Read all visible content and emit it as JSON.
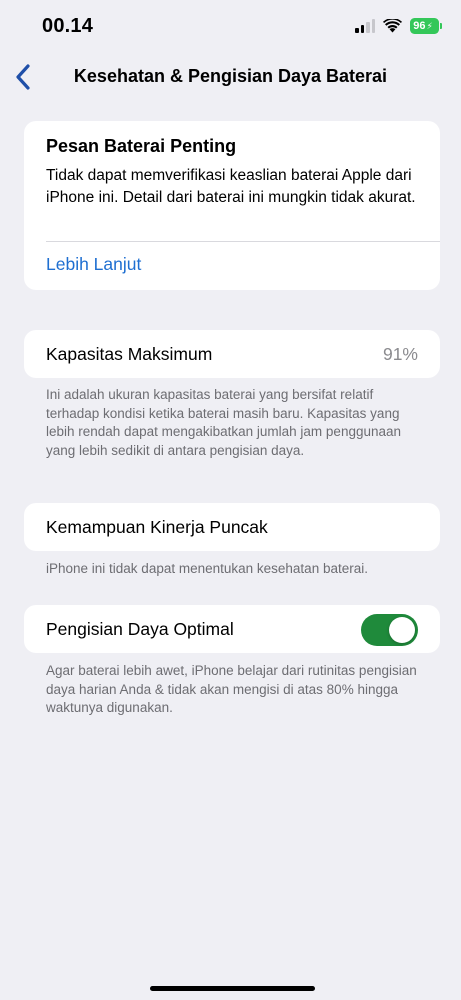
{
  "status_bar": {
    "time": "00.14",
    "battery": "96",
    "signal_icon": "cellular-signal-icon",
    "wifi_icon": "wifi-icon",
    "battery_icon": "battery-charging-icon",
    "battery_color": "#34c759"
  },
  "nav": {
    "title": "Kesehatan & Pengisian Daya Baterai",
    "back_icon": "chevron-left-icon",
    "accent": "#1f6fd1"
  },
  "important_message": {
    "title": "Pesan Baterai Penting",
    "body": "Tidak dapat memverifikasi keaslian baterai Apple dari iPhone ini. Detail dari baterai ini mungkin tidak akurat.",
    "link": "Lebih Lanjut"
  },
  "maximum_capacity": {
    "label": "Kapasitas Maksimum",
    "value": "91%",
    "note": "Ini adalah ukuran kapasitas baterai yang bersifat relatif terhadap kondisi ketika baterai masih baru. Kapasitas yang lebih rendah dapat mengakibatkan jumlah jam penggunaan yang lebih sedikit di antara pengisian daya."
  },
  "peak_performance": {
    "label": "Kemampuan Kinerja Puncak",
    "note": "iPhone ini tidak dapat menentukan kesehatan baterai."
  },
  "optimized_charging": {
    "label": "Pengisian Daya Optimal",
    "enabled": true,
    "toggle_color": "#1f8a3b",
    "note": "Agar baterai lebih awet, iPhone belajar dari rutinitas pengisian daya harian Anda & tidak akan mengisi di atas 80% hingga waktunya digunakan."
  }
}
